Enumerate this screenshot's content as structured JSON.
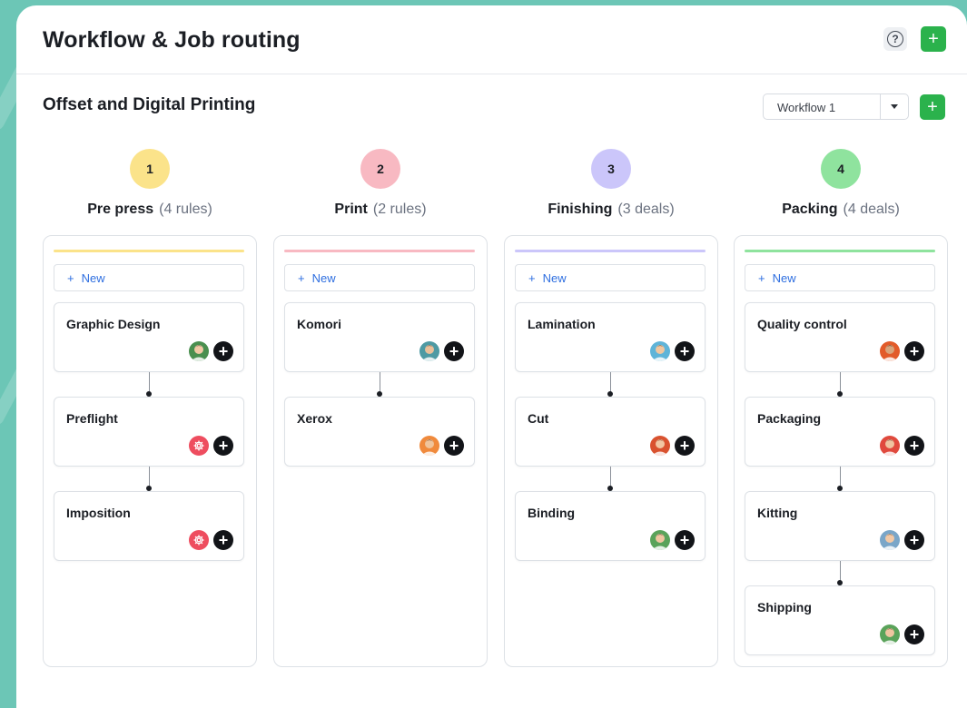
{
  "app": {
    "title": "Workflow & Job routing",
    "help_glyph": "?",
    "add_glyph": "+"
  },
  "subheader": {
    "title": "Offset and Digital Printing",
    "workflow_select": {
      "value": "Workflow 1"
    },
    "add_glyph": "+"
  },
  "new_label": "New",
  "new_plus": "+",
  "add_assignee_glyph": "+",
  "colors": {
    "brand_green": "#2bb24c",
    "link_blue": "#2f6fe0",
    "gear_red": "#ee4d5f"
  },
  "columns": [
    {
      "number": "1",
      "name": "Pre press",
      "count": "(4 rules)",
      "color": "#fbe38a",
      "tasks": [
        {
          "name": "Graphic Design",
          "assignee": "avatar-man-beard"
        },
        {
          "name": "Preflight",
          "assignee": "gear-icon"
        },
        {
          "name": "Imposition",
          "assignee": "gear-icon"
        }
      ]
    },
    {
      "number": "2",
      "name": "Print",
      "count": "(2 rules)",
      "color": "#f8b9c2",
      "tasks": [
        {
          "name": "Komori",
          "assignee": "avatar-man-teal"
        },
        {
          "name": "Xerox",
          "assignee": "avatar-man-orange"
        }
      ]
    },
    {
      "number": "3",
      "name": "Finishing",
      "count": "(3 deals)",
      "color": "#cbc6fa",
      "tasks": [
        {
          "name": "Lamination",
          "assignee": "avatar-man-blue"
        },
        {
          "name": "Cut",
          "assignee": "avatar-woman-red"
        },
        {
          "name": "Binding",
          "assignee": "avatar-man-green"
        }
      ]
    },
    {
      "number": "4",
      "name": "Packing",
      "count": "(4 deals)",
      "color": "#8fe39e",
      "tasks": [
        {
          "name": "Quality control",
          "assignee": "avatar-man-dark"
        },
        {
          "name": "Packaging",
          "assignee": "avatar-man-red"
        },
        {
          "name": "Kitting",
          "assignee": "avatar-man-gray"
        },
        {
          "name": "Shipping",
          "assignee": "avatar-man-green"
        }
      ]
    }
  ]
}
